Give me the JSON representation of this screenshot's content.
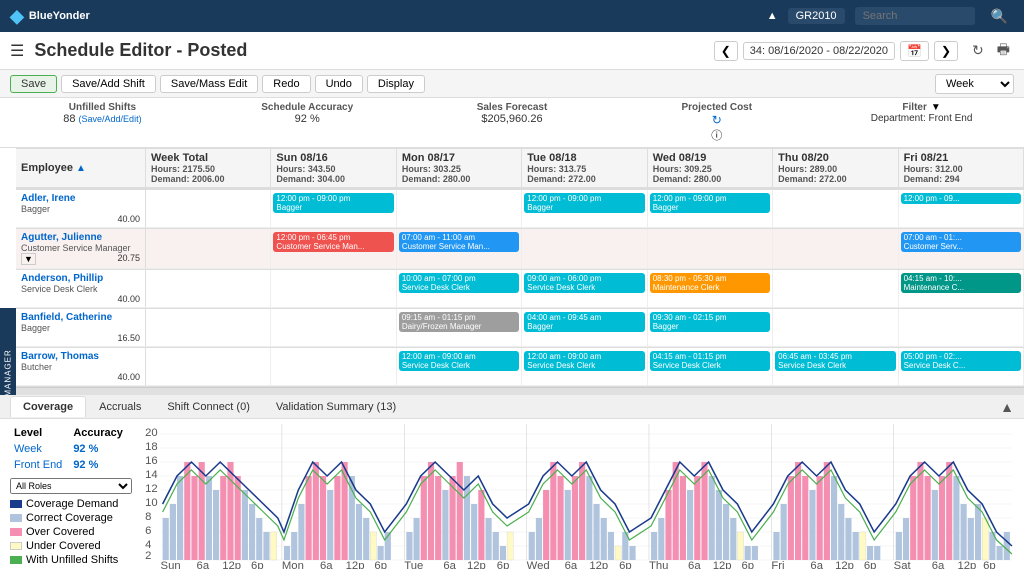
{
  "topNav": {
    "logo": "BlueYonder",
    "user": "GR2010",
    "searchPlaceholder": "Search"
  },
  "header": {
    "title": "Schedule Editor - Posted",
    "dateRange": "34: 08/16/2020 - 08/22/2020"
  },
  "toolbar": {
    "buttons": [
      "Save",
      "Save/Add Shift",
      "Save/Mass Edit",
      "Redo",
      "Undo",
      "Display"
    ],
    "viewMode": "Week"
  },
  "stats": {
    "unfilled": {
      "label": "Unfilled Shifts",
      "value": "88",
      "link": "(Save/Add/Edit)"
    },
    "accuracy": {
      "label": "Schedule Accuracy",
      "value": "92 %"
    },
    "salesForecast": {
      "label": "Sales Forecast",
      "value": "$205,960.26"
    },
    "projectedCost": {
      "label": "Projected Cost"
    },
    "filter": {
      "label": "Filter",
      "dept": "Department: Front End"
    }
  },
  "gridHeaders": {
    "employee": "Employee",
    "weekTotal": {
      "label": "Week Total",
      "hours": "Hours: 2175.50",
      "demand": "Demand: 2006.00"
    },
    "days": [
      {
        "day": "Sun 08/16",
        "hours": "Hours: 343.50",
        "demand": "Demand: 304.00"
      },
      {
        "day": "Mon 08/17",
        "hours": "Hours: 303.25",
        "demand": "Demand: 280.00"
      },
      {
        "day": "Tue 08/18",
        "hours": "Hours: 313.75",
        "demand": "Demand: 272.00"
      },
      {
        "day": "Wed 08/19",
        "hours": "Hours: 309.25",
        "demand": "Demand: 280.00"
      },
      {
        "day": "Thu 08/20",
        "hours": "Hours: 289.00",
        "demand": "Demand: 272.00"
      },
      {
        "day": "Fri 08/21",
        "hours": "Hours: 312.00",
        "demand": "Demand: 294"
      }
    ]
  },
  "employees": [
    {
      "name": "Adler, Irene",
      "role": "Bagger",
      "hours": "40.00",
      "shifts": [
        {
          "day": 0,
          "text": "12:00 pm - 09:00 pm\nBagger",
          "color": "cyan"
        },
        {
          "day": 1,
          "text": "",
          "color": ""
        },
        {
          "day": 2,
          "text": "12:00 pm - 09:00 pm\nBagger",
          "color": "cyan"
        },
        {
          "day": 3,
          "text": "12:00 pm - 09:00 pm\nBagger",
          "color": "cyan"
        },
        {
          "day": 4,
          "text": "",
          "color": ""
        },
        {
          "day": 5,
          "text": "12:00 pm - 09...",
          "color": "cyan"
        }
      ]
    },
    {
      "name": "Agutter, Julienne",
      "role": "Customer Service Manager",
      "hours": "20.75",
      "shifts": [
        {
          "day": 0,
          "text": "12:00 pm - 06:45 pm\nCustomer Service Man...",
          "color": "red"
        },
        {
          "day": 1,
          "text": "07:00 am - 11:00 am\nCustomer Service Man...",
          "color": "blue"
        },
        {
          "day": 2,
          "text": "",
          "color": ""
        },
        {
          "day": 3,
          "text": "",
          "color": ""
        },
        {
          "day": 4,
          "text": "",
          "color": ""
        },
        {
          "day": 5,
          "text": "07:00 am - 01:...\nCustomer Serv...",
          "color": "blue"
        }
      ]
    },
    {
      "name": "Anderson, Phillip",
      "role": "Service Desk Clerk",
      "hours": "40.00",
      "shifts": [
        {
          "day": 0,
          "text": "",
          "color": ""
        },
        {
          "day": 1,
          "text": "10:00 am - 07:00 pm\nService Desk Clerk",
          "color": "cyan"
        },
        {
          "day": 2,
          "text": "09:00 am - 06:00 pm\nService Desk Clerk",
          "color": "cyan"
        },
        {
          "day": 3,
          "text": "08:30 pm - 05:30 am\nMaintenance Clerk",
          "color": "orange"
        },
        {
          "day": 4,
          "text": "",
          "color": ""
        },
        {
          "day": 5,
          "text": "04:15 am - 10:...\nMaintenance C...",
          "color": "teal"
        }
      ]
    },
    {
      "name": "Banfield, Catherine",
      "role": "Bagger",
      "hours": "16.50",
      "shifts": [
        {
          "day": 0,
          "text": "",
          "color": ""
        },
        {
          "day": 1,
          "text": "09:15 am - 01:15 pm\nDairy/Frozen Manager",
          "color": "gray"
        },
        {
          "day": 2,
          "text": "04:00 am - 09:45 am\nBagger",
          "color": "cyan"
        },
        {
          "day": 3,
          "text": "09:30 am - 02:15 pm\nBagger",
          "color": "cyan"
        },
        {
          "day": 4,
          "text": "",
          "color": ""
        },
        {
          "day": 5,
          "text": "",
          "color": ""
        }
      ]
    },
    {
      "name": "Barrow, Thomas",
      "role": "Butcher",
      "hours": "40.00",
      "shifts": [
        {
          "day": 0,
          "text": "",
          "color": ""
        },
        {
          "day": 1,
          "text": "12:00 am - 09:00 am\nService Desk Clerk",
          "color": "cyan"
        },
        {
          "day": 2,
          "text": "12:00 am - 09:00 am\nService Desk Clerk",
          "color": "cyan"
        },
        {
          "day": 3,
          "text": "04:15 am - 01:15 pm\nService Desk Clerk",
          "color": "cyan"
        },
        {
          "day": 4,
          "text": "06:45 am - 03:45 pm\nService Desk Clerk",
          "color": "cyan"
        },
        {
          "day": 5,
          "text": "05:00 pm - 02:...\nService Desk C...",
          "color": "cyan"
        }
      ]
    }
  ],
  "bottomTabs": [
    "Coverage",
    "Accruals",
    "Shift Connect (0)",
    "Validation Summary (13)"
  ],
  "coverageLevels": [
    {
      "label": "Week",
      "accuracy": "92 %"
    },
    {
      "label": "Front End",
      "accuracy": "92 %"
    }
  ],
  "roles": "All Roles",
  "legend": [
    {
      "label": "Coverage Demand",
      "color": "#1a3a8c"
    },
    {
      "label": "Correct Coverage",
      "color": "#b0c4de"
    },
    {
      "label": "Over Covered",
      "color": "#f48fb1"
    },
    {
      "label": "Under Covered",
      "color": "#fff9c4"
    },
    {
      "label": "With Unfilled Shifts",
      "color": "#4caf50"
    }
  ],
  "chartDays": [
    "Sun",
    "Mon",
    "Tue",
    "Wed",
    "Thu",
    "Fri",
    "Sat"
  ],
  "chartYMax": 20,
  "chartYLabels": [
    2,
    4,
    6,
    8,
    10,
    12,
    14,
    16,
    18,
    20
  ],
  "sideLabel": "WFM SITE MANAGER"
}
